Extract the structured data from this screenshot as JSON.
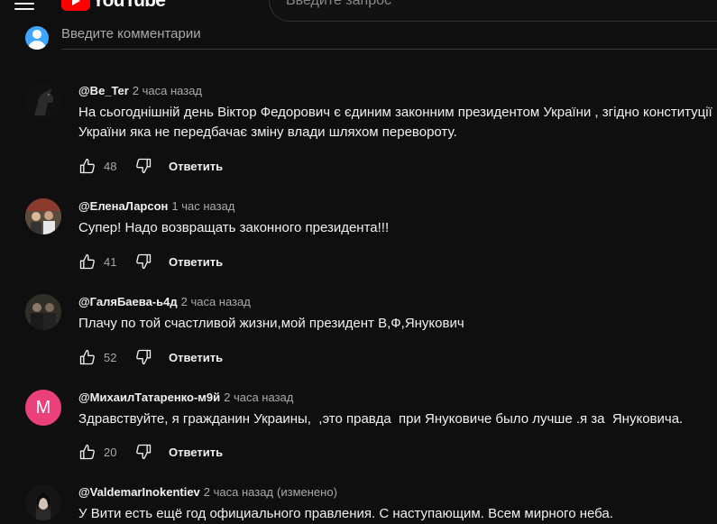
{
  "header": {
    "logo_text": "YouTube",
    "search_placeholder": "Введите запрос"
  },
  "comment_box": {
    "placeholder": "Введите комментарии"
  },
  "colors": {
    "background": "#0f0f0f",
    "text": "#f1f1f1",
    "secondary_text": "#aaaaaa",
    "accent_red": "#ff0000",
    "avatar_m": "#ec407a"
  },
  "comments": [
    {
      "author": "@Be_Ter",
      "time": "2 часа назад",
      "text": "На сьогоднішній день Віктор Федорович є єдиним законним президентом України , згідно конституції України яка не передбачає зміну влади шляхом перевороту.",
      "likes": "48",
      "reply_label": "Ответить"
    },
    {
      "author": "@ЕленаЛарсон",
      "time": "1 час назад",
      "text": "Супер! Надо возвращать законного президента!!!",
      "likes": "41",
      "reply_label": "Ответить"
    },
    {
      "author": "@ГаляБаева-ь4д",
      "time": "2 часа назад",
      "text": "Плачу по той счастливой жизни,мой президент В,Ф,Янукович",
      "likes": "52",
      "reply_label": "Ответить"
    },
    {
      "author": "@МихаилТатаренко-м9й",
      "time": "2 часа назад",
      "avatar_letter": "M",
      "text": "Здравствуйте, я гражданин Украины,  ,это правда  при Януковиче было лучше .я за  Януковича.",
      "likes": "20",
      "reply_label": "Ответить"
    },
    {
      "author": "@ValdemarInokentiev",
      "time": "2 часа назад",
      "edited": "(изменено)",
      "text": "У Вити есть ещё год официального правления. С наступающим. Всем мирного неба."
    }
  ]
}
